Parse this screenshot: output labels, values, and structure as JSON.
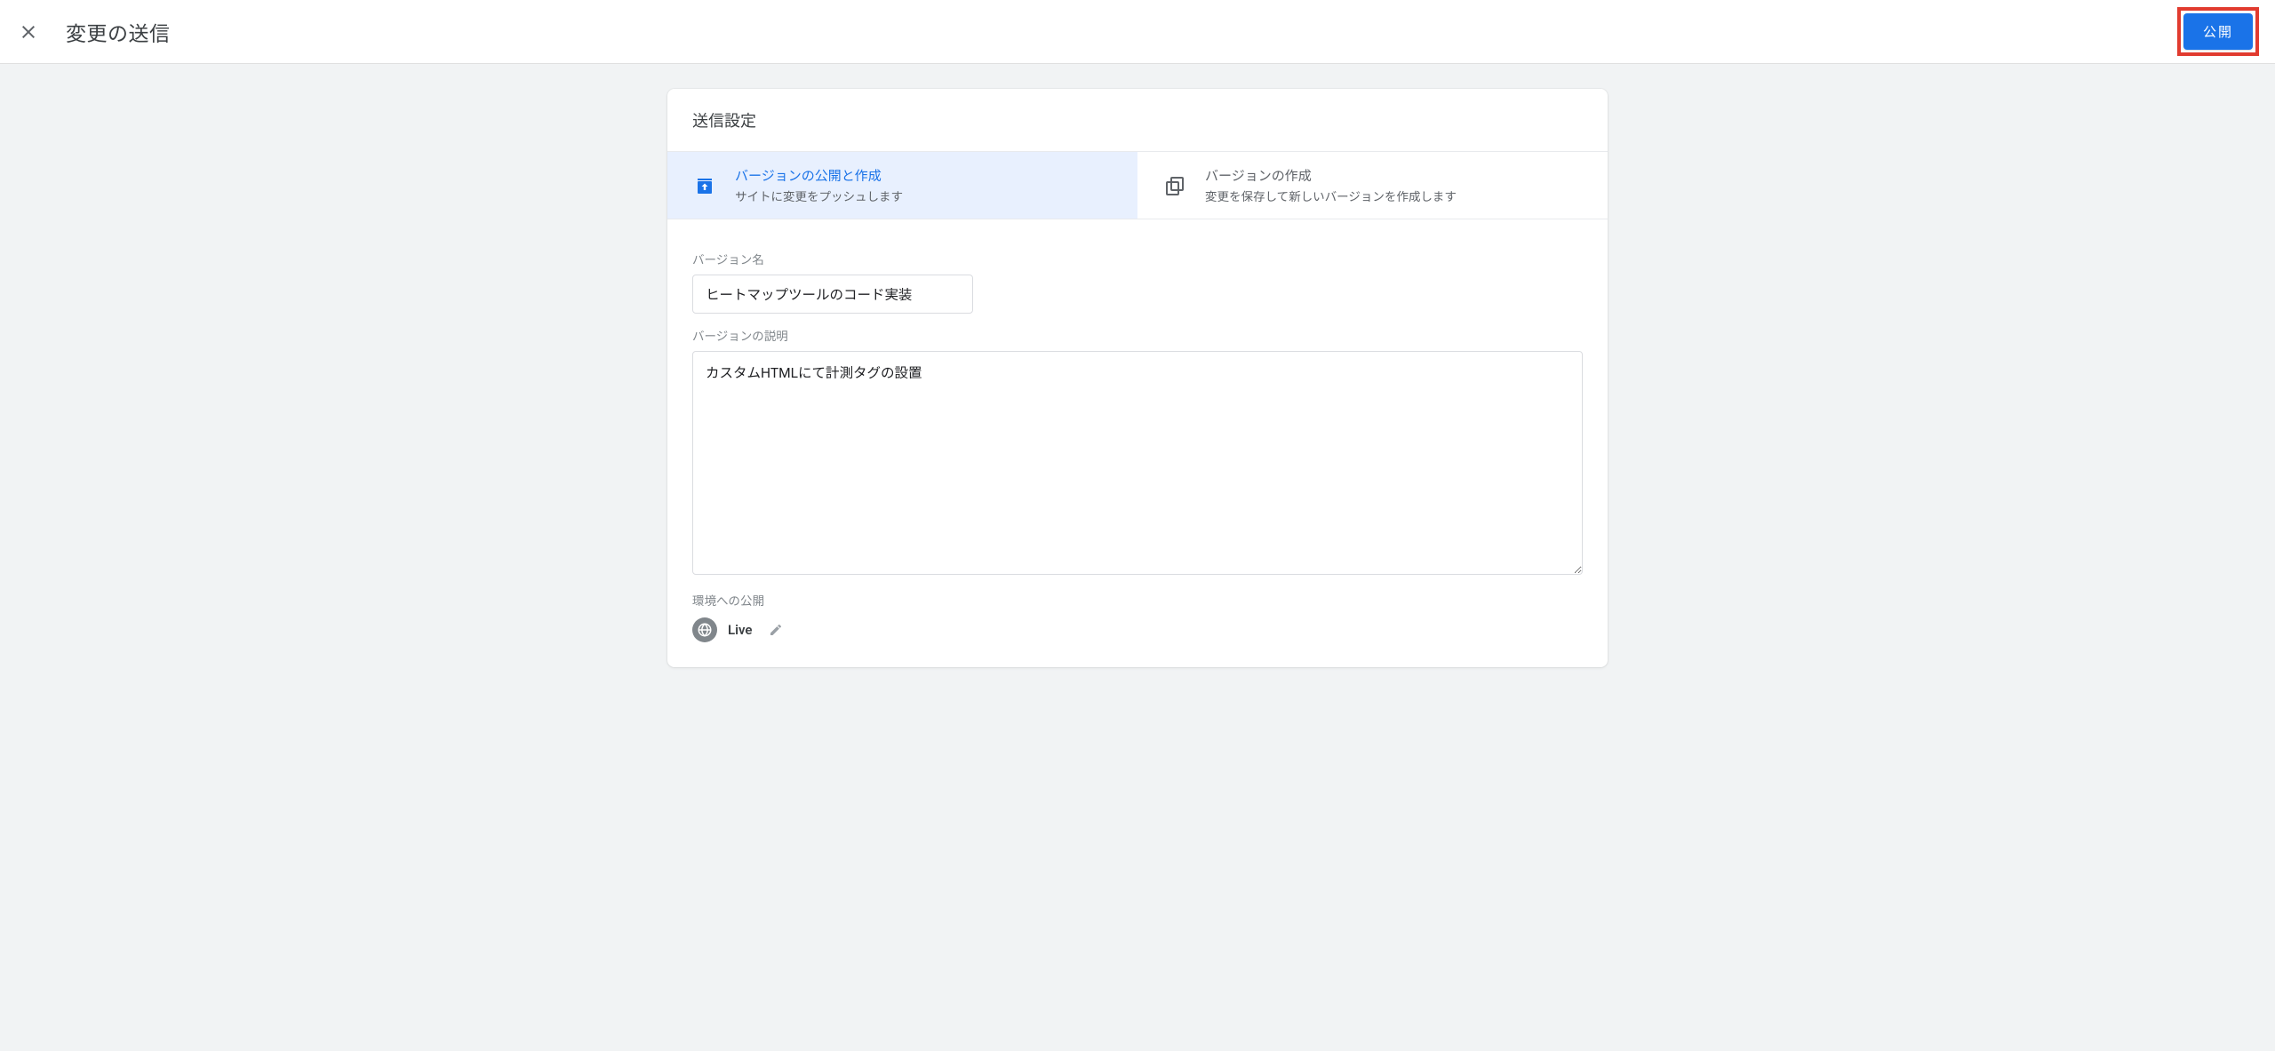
{
  "header": {
    "title": "変更の送信",
    "publish_label": "公開"
  },
  "card": {
    "title": "送信設定",
    "tabs": [
      {
        "label": "バージョンの公開と作成",
        "desc": "サイトに変更をプッシュします"
      },
      {
        "label": "バージョンの作成",
        "desc": "変更を保存して新しいバージョンを作成します"
      }
    ],
    "version_name_label": "バージョン名",
    "version_name_value": "ヒートマップツールのコード実装",
    "version_desc_label": "バージョンの説明",
    "version_desc_value": "カスタムHTMLにて計測タグの設置",
    "publish_env_label": "環境への公開",
    "env_name": "Live"
  }
}
